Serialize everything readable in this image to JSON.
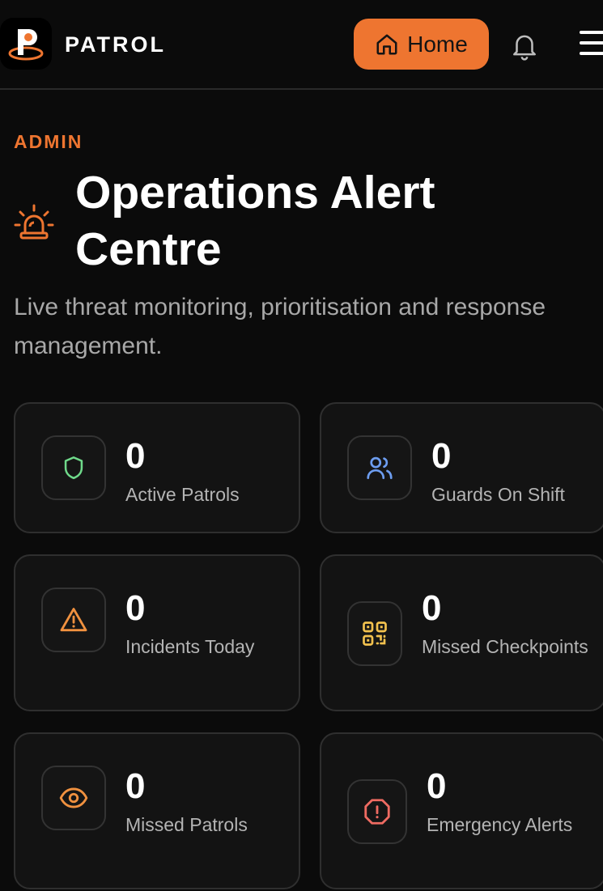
{
  "header": {
    "brand": "PATROL",
    "home_label": "Home"
  },
  "page": {
    "eyebrow": "ADMIN",
    "title": "Operations Alert Centre",
    "subtitle": "Live threat monitoring, prioritisation and response management."
  },
  "stats": [
    {
      "value": "0",
      "label": "Active Patrols",
      "icon": "shield-icon",
      "color": "#6fd98a"
    },
    {
      "value": "0",
      "label": "Guards On Shift",
      "icon": "users-icon",
      "color": "#6d9df0"
    },
    {
      "value": "0",
      "label": "Incidents Today",
      "icon": "warning-triangle-icon",
      "color": "#f0913f"
    },
    {
      "value": "0",
      "label": "Missed Checkpoints",
      "icon": "qr-code-icon",
      "color": "#f2c14e"
    },
    {
      "value": "0",
      "label": "Missed Patrols",
      "icon": "eye-icon",
      "color": "#f0913f"
    },
    {
      "value": "0",
      "label": "Emergency Alerts",
      "icon": "alert-octagon-icon",
      "color": "#ee6b62"
    }
  ],
  "colors": {
    "accent": "#ee7530",
    "background": "#0b0b0b",
    "card": "#131313"
  }
}
